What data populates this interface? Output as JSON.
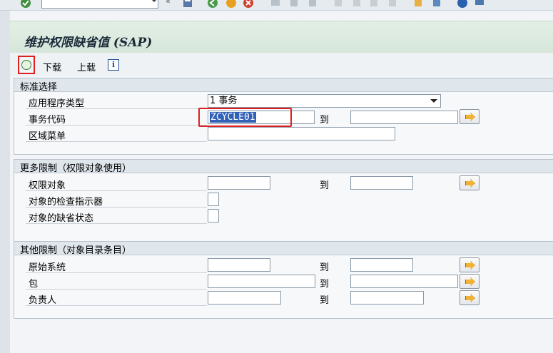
{
  "page": {
    "title": "维护权限缺省值 (SAP)"
  },
  "toolbar": {
    "download_label": "下载",
    "upload_label": "上载",
    "info_label": "i"
  },
  "groups": [
    {
      "title": "标准选择",
      "rows": [
        {
          "label": "应用程序类型",
          "value": "1 事务"
        },
        {
          "label": "事务代码",
          "value": "ZCYCLE01",
          "to": "到"
        },
        {
          "label": "区域菜单",
          "value": ""
        }
      ]
    },
    {
      "title": "更多限制（权限对象使用）",
      "rows": [
        {
          "label": "权限对象",
          "value": "",
          "to": "到"
        },
        {
          "label": "对象的检查指示器",
          "value": ""
        },
        {
          "label": "对象的缺省状态",
          "value": ""
        }
      ]
    },
    {
      "title": "其他限制（对象目录条目）",
      "rows": [
        {
          "label": "原始系统",
          "value": "",
          "to": "到"
        },
        {
          "label": "包",
          "value": "",
          "to": "到"
        },
        {
          "label": "负责人",
          "value": "",
          "to": "到"
        }
      ]
    }
  ]
}
